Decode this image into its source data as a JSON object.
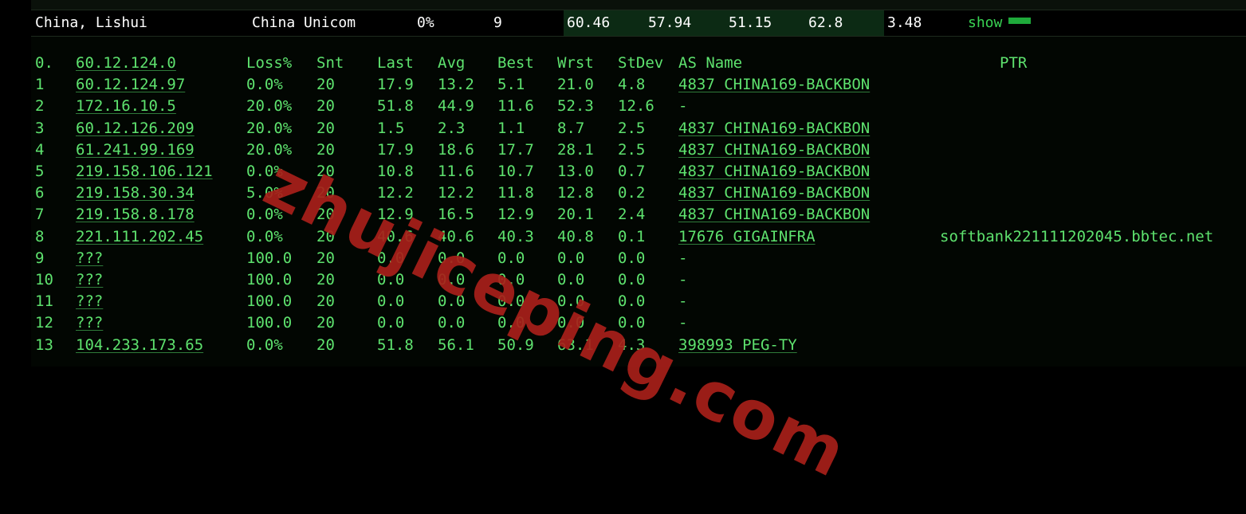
{
  "summary": {
    "location": "China, Lishui",
    "isp": "China Unicom",
    "loss": "0%",
    "hops": "9",
    "v1": "60.46",
    "v2": "57.94",
    "v3": "51.15",
    "v4": "62.8",
    "v5": "3.48",
    "show_label": "show"
  },
  "header": [
    "0.",
    "60.12.124.0",
    "Loss%",
    "Snt",
    "Last",
    "Avg",
    "Best",
    "Wrst",
    "StDev",
    "AS Name",
    "PTR"
  ],
  "rows": [
    [
      "1",
      "60.12.124.97",
      "0.0%",
      "20",
      "17.9",
      "13.2",
      "5.1",
      "21.0",
      "4.8",
      "4837  CHINA169-BACKBON",
      ""
    ],
    [
      "2",
      "172.16.10.5",
      "20.0%",
      "20",
      "51.8",
      "44.9",
      "11.6",
      "52.3",
      "12.6",
      "-",
      ""
    ],
    [
      "3",
      "60.12.126.209",
      "20.0%",
      "20",
      "1.5",
      "2.3",
      "1.1",
      "8.7",
      "2.5",
      "4837  CHINA169-BACKBON",
      ""
    ],
    [
      "4",
      "61.241.99.169",
      "20.0%",
      "20",
      "17.9",
      "18.6",
      "17.7",
      "28.1",
      "2.5",
      "4837  CHINA169-BACKBON",
      ""
    ],
    [
      "5",
      "219.158.106.121",
      "0.0%",
      "20",
      "10.8",
      "11.6",
      "10.7",
      "13.0",
      "0.7",
      "4837  CHINA169-BACKBON",
      ""
    ],
    [
      "6",
      "219.158.30.34",
      "5.0%",
      "20",
      "12.2",
      "12.2",
      "11.8",
      "12.8",
      "0.2",
      "4837  CHINA169-BACKBON",
      ""
    ],
    [
      "7",
      "219.158.8.178",
      "0.0%",
      "20",
      "12.9",
      "16.5",
      "12.9",
      "20.1",
      "2.4",
      "4837  CHINA169-BACKBON",
      ""
    ],
    [
      "8",
      "221.111.202.45",
      "0.0%",
      "20",
      "40.6",
      "40.6",
      "40.3",
      "40.8",
      "0.1",
      "17676 GIGAINFRA",
      "softbank221111202045.bbtec.net"
    ],
    [
      "9",
      "???",
      "100.0",
      "20",
      "0.0",
      "0.0",
      "0.0",
      "0.0",
      "0.0",
      "-",
      ""
    ],
    [
      "10",
      "???",
      "100.0",
      "20",
      "0.0",
      "0.0",
      "0.0",
      "0.0",
      "0.0",
      "-",
      ""
    ],
    [
      "11",
      "???",
      "100.0",
      "20",
      "0.0",
      "0.0",
      "0.0",
      "0.0",
      "0.0",
      "-",
      ""
    ],
    [
      "12",
      "???",
      "100.0",
      "20",
      "0.0",
      "0.0",
      "0.0",
      "0.0",
      "0.0",
      "-",
      ""
    ],
    [
      "13",
      "104.233.173.65",
      "0.0%",
      "20",
      "51.8",
      "56.1",
      "50.9",
      "63.1",
      "4.3",
      "398993 PEG-TY",
      ""
    ]
  ],
  "watermark": "zhujiceping.com",
  "colors": {
    "text_green": "#5ee26e",
    "band_green": "#0c2a14",
    "watermark_red": "#a8201a"
  }
}
